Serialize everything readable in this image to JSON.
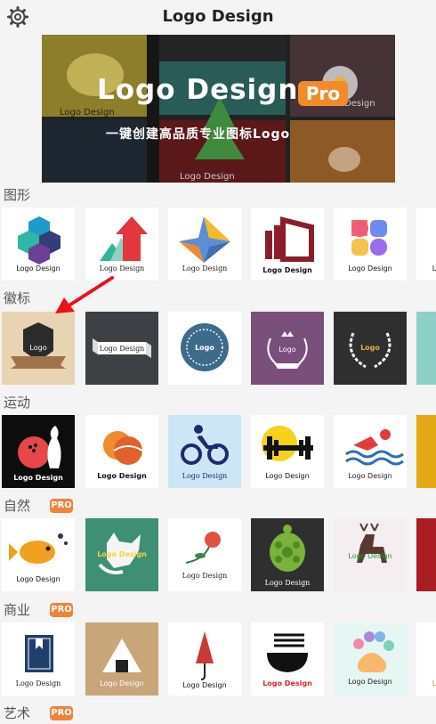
{
  "header": {
    "title": "Logo Design"
  },
  "banner": {
    "title": "Logo Design",
    "badge": "Pro",
    "subtitle": "一键创建高品质专业图标Logo"
  },
  "sections": [
    {
      "label": "图形",
      "pro": false,
      "cards": [
        "Logo Design",
        "Logo Design",
        "Logo Design",
        "Logo Design",
        "Logo Design",
        "L"
      ]
    },
    {
      "label": "徽标",
      "pro": false,
      "cards": [
        "Logo",
        "Logo Design",
        "Logo",
        "Logo",
        "Logo",
        ""
      ]
    },
    {
      "label": "运动",
      "pro": false,
      "cards": [
        "Logo Design",
        "Logo Design",
        "Logo Design",
        "Logo Design",
        "Logo Design",
        ""
      ]
    },
    {
      "label": "自然",
      "pro": true,
      "pro_label": "PRO",
      "cards": [
        "Logo Design",
        "Logo Design",
        "Logo Design",
        "Logo Design",
        "Logo Design",
        ""
      ]
    },
    {
      "label": "商业",
      "pro": true,
      "pro_label": "PRO",
      "cards": [
        "Logo Design",
        "Logo Design",
        "Logo Design",
        "Logo Design",
        "Logo Design",
        "L"
      ]
    },
    {
      "label": "艺术",
      "pro": true,
      "pro_label": "PRO",
      "cards": []
    }
  ],
  "colors": {
    "accent": "#f0833a",
    "arrow": "#e8141b"
  }
}
